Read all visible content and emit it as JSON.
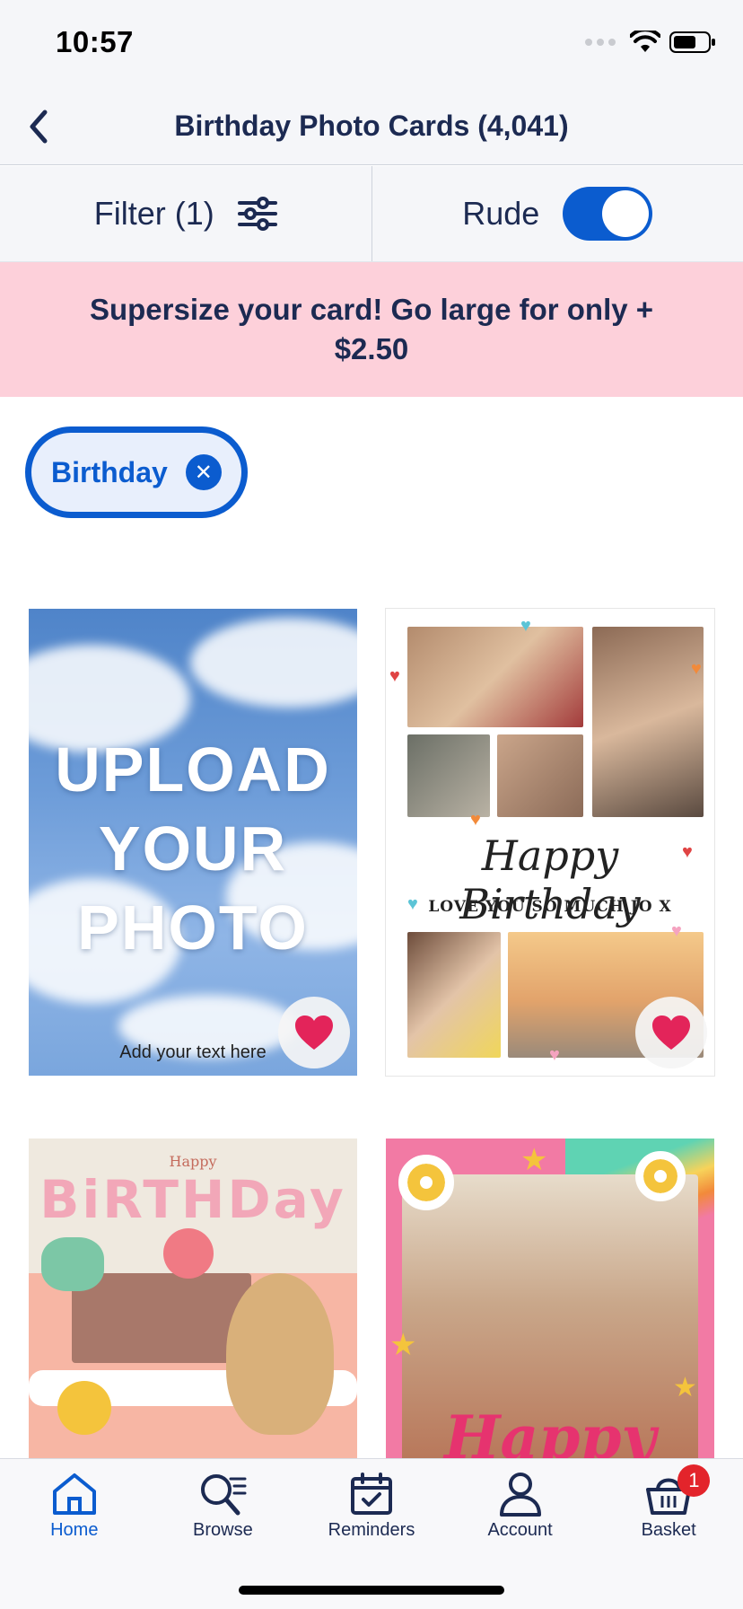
{
  "status_bar": {
    "time": "10:57"
  },
  "header": {
    "title": "Birthday Photo Cards (4,041)"
  },
  "filters": {
    "filter_label": "Filter (1)",
    "toggle_label": "Rude",
    "toggle_on": true
  },
  "promo": {
    "text": "Supersize your card! Go large for only + $2.50"
  },
  "active_chip": {
    "label": "Birthday"
  },
  "cards": [
    {
      "line1": "UPLOAD",
      "line2": "YOUR",
      "line3": "PHOTO",
      "caption": "Add your text here"
    },
    {
      "headline": "Happy Birthday",
      "subline": "LOVE YOU SO MUCH JO X"
    },
    {
      "small": "Happy",
      "big": "BiRTHDay"
    },
    {
      "word": "Happy"
    }
  ],
  "tab_bar": {
    "tabs": [
      {
        "label": "Home",
        "icon": "home-icon",
        "active": true
      },
      {
        "label": "Browse",
        "icon": "browse-search-icon",
        "active": false
      },
      {
        "label": "Reminders",
        "icon": "calendar-icon",
        "active": false
      },
      {
        "label": "Account",
        "icon": "person-icon",
        "active": false
      },
      {
        "label": "Basket",
        "icon": "basket-icon",
        "active": false
      }
    ],
    "basket_badge": "1"
  },
  "colors": {
    "primary": "#0b5ccf",
    "navy": "#1c2a52",
    "promo_bg": "#fdd0da",
    "favorite": "#e3245a"
  }
}
